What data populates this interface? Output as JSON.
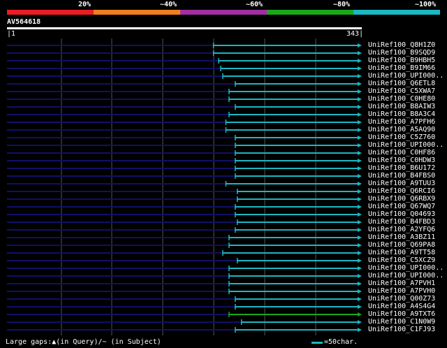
{
  "legend": {
    "labels": [
      "20%",
      "~40%",
      "~60%",
      "~80%",
      "~100%"
    ],
    "colors": [
      "#ed1c24",
      "#f07f1f",
      "#a12fa3",
      "#1aa81a",
      "#1ab8c2"
    ]
  },
  "query": {
    "id": "AV564618",
    "start_label": "1",
    "end_label": "343",
    "length": 343
  },
  "colors": {
    "hit": "#1ab8c2",
    "hit_green": "#1aa81a",
    "unaligned": "#10106a",
    "grid": "#555555"
  },
  "hits": [
    {
      "name": "UniRef100_Q8H1Z0",
      "start": 200,
      "color": "cyan"
    },
    {
      "name": "UniRef100_B9SQD9",
      "start": 200,
      "color": "cyan"
    },
    {
      "name": "UniRef100_B9HBH5",
      "start": 205,
      "color": "cyan"
    },
    {
      "name": "UniRef100_B9IM66",
      "start": 207,
      "color": "cyan"
    },
    {
      "name": "UniRef100_UPI000..",
      "start": 209,
      "color": "cyan"
    },
    {
      "name": "UniRef100_Q6ETL8",
      "start": 221,
      "color": "cyan"
    },
    {
      "name": "UniRef100_C5XWA7",
      "start": 215,
      "color": "cyan"
    },
    {
      "name": "UniRef100_C0HE80",
      "start": 215,
      "color": "cyan"
    },
    {
      "name": "UniRef100_B8AIW3",
      "start": 221,
      "color": "cyan"
    },
    {
      "name": "UniRef100_B8A3C4",
      "start": 215,
      "color": "cyan"
    },
    {
      "name": "UniRef100_A7PFH6",
      "start": 212,
      "color": "cyan"
    },
    {
      "name": "UniRef100_A5AQ90",
      "start": 212,
      "color": "cyan"
    },
    {
      "name": "UniRef100_C5Z760",
      "start": 221,
      "color": "cyan"
    },
    {
      "name": "UniRef100_UPI000..",
      "start": 221,
      "color": "cyan"
    },
    {
      "name": "UniRef100_C0HF86",
      "start": 221,
      "color": "cyan"
    },
    {
      "name": "UniRef100_C0HDW3",
      "start": 221,
      "color": "cyan"
    },
    {
      "name": "UniRef100_B6U172",
      "start": 221,
      "color": "cyan"
    },
    {
      "name": "UniRef100_B4FBS0",
      "start": 221,
      "color": "cyan"
    },
    {
      "name": "UniRef100_A9TUU3",
      "start": 212,
      "color": "cyan"
    },
    {
      "name": "UniRef100_Q6RCI6",
      "start": 223,
      "color": "cyan"
    },
    {
      "name": "UniRef100_Q6RBX9",
      "start": 223,
      "color": "cyan"
    },
    {
      "name": "UniRef100_Q67WQ7",
      "start": 221,
      "color": "cyan"
    },
    {
      "name": "UniRef100_Q04693",
      "start": 221,
      "color": "cyan"
    },
    {
      "name": "UniRef100_B4FBD3",
      "start": 223,
      "color": "cyan"
    },
    {
      "name": "UniRef100_A2YFQ6",
      "start": 221,
      "color": "cyan"
    },
    {
      "name": "UniRef100_A3BZ11",
      "start": 215,
      "color": "cyan"
    },
    {
      "name": "UniRef100_Q69PA8",
      "start": 215,
      "color": "cyan"
    },
    {
      "name": "UniRef100_A9TT58",
      "start": 209,
      "color": "cyan"
    },
    {
      "name": "UniRef100_C5XCZ9",
      "start": 223,
      "color": "cyan"
    },
    {
      "name": "UniRef100_UPI000..",
      "start": 215,
      "color": "cyan"
    },
    {
      "name": "UniRef100_UPI000..",
      "start": 215,
      "color": "cyan"
    },
    {
      "name": "UniRef100_A7PVH1",
      "start": 215,
      "color": "cyan"
    },
    {
      "name": "UniRef100_A7PVH0",
      "start": 215,
      "color": "cyan"
    },
    {
      "name": "UniRef100_Q00Z73",
      "start": 221,
      "color": "cyan"
    },
    {
      "name": "UniRef100_A4S4G4",
      "start": 221,
      "color": "cyan"
    },
    {
      "name": "UniRef100_A9TXT6",
      "start": 215,
      "color": "green"
    },
    {
      "name": "UniRef100_C1N0W9",
      "start": 227,
      "color": "cyan"
    },
    {
      "name": "UniRef100_C1FJ93",
      "start": 221,
      "color": "cyan"
    }
  ],
  "footer": {
    "gaps_prefix": "Large gaps:",
    "gap_query_symbol": "▲",
    "gap_query_text": "(in Query)/",
    "gap_subject_symbol": "~",
    "gap_subject_text": " (in Subject)",
    "scale_text": "=50char."
  }
}
